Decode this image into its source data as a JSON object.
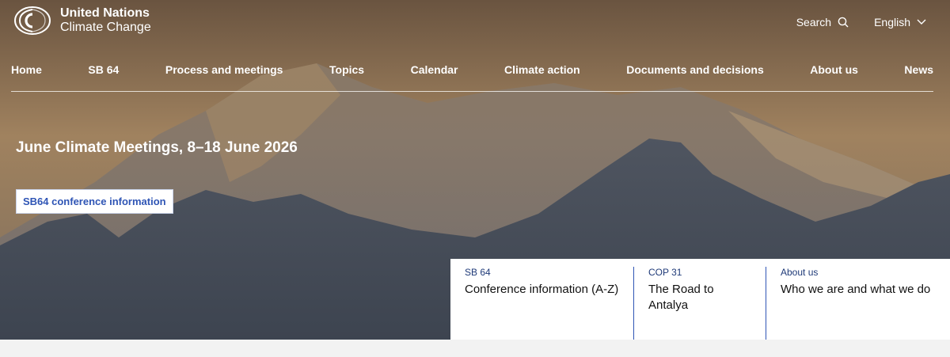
{
  "brand": {
    "line1": "United Nations",
    "line2": "Climate Change",
    "icon": "unfccc-logo-icon"
  },
  "utility": {
    "search_label": "Search",
    "search_icon": "search-icon",
    "language_label": "English",
    "language_icon": "chevron-down-icon"
  },
  "nav": {
    "items": [
      {
        "label": "Home"
      },
      {
        "label": "SB 64"
      },
      {
        "label": "Process and meetings"
      },
      {
        "label": "Topics"
      },
      {
        "label": "Calendar"
      },
      {
        "label": "Climate action"
      },
      {
        "label": "Documents and decisions"
      },
      {
        "label": "About us"
      },
      {
        "label": "News"
      }
    ]
  },
  "hero": {
    "headline": "June Climate Meetings, 8–18 June 2026",
    "cta_label": "SB64 conference information"
  },
  "cards": [
    {
      "eyebrow": "SB 64",
      "title": "Conference information (A-Z)"
    },
    {
      "eyebrow": "COP 31",
      "title": "The Road to Antalya"
    },
    {
      "eyebrow": "About us",
      "title": "Who we are and what we do"
    }
  ],
  "colors": {
    "accent": "#2f55b5",
    "eyebrow": "#1f3a78"
  }
}
